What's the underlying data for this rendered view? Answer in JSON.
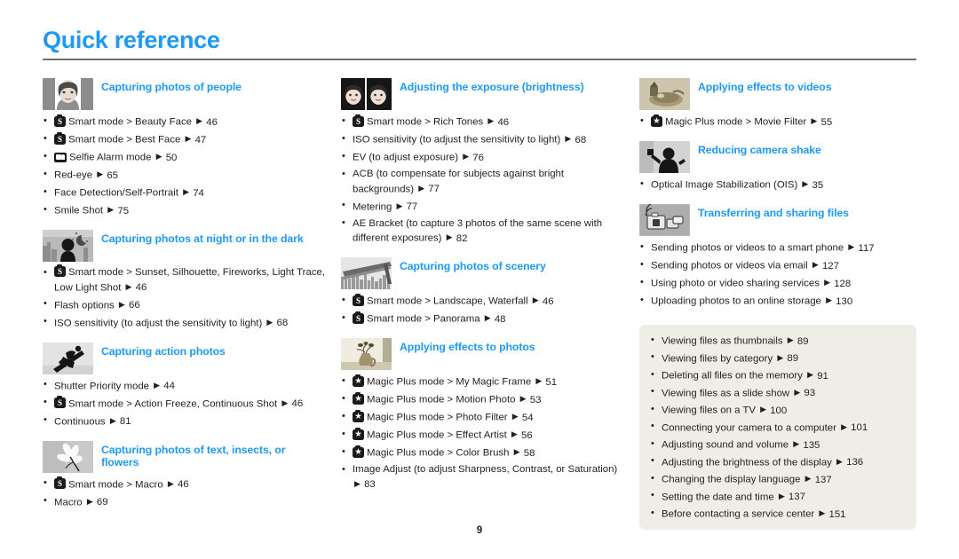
{
  "page": {
    "title": "Quick reference",
    "folio": "9",
    "accent_color": "#1e99f5",
    "text_color": "#231f20",
    "tipbox_color": "#efeee6",
    "rule_color": "#6f6f6f"
  },
  "columns": [
    {
      "sections": [
        {
          "title": "Capturing photos of people",
          "thumb_icon": "portrait-woman-thumbnail",
          "items": [
            {
              "badge": "smart-mode-badge",
              "text": "Smart mode > Beauty Face",
              "page": "46"
            },
            {
              "badge": "smart-mode-badge",
              "text": "Smart mode > Best Face",
              "page": "47"
            },
            {
              "badge": "selfie-alarm-badge",
              "text": "Selfie Alarm mode",
              "page": "50"
            },
            {
              "badge": null,
              "text": "Red-eye",
              "page": "65"
            },
            {
              "badge": null,
              "text": "Face Detection/Self-Portrait",
              "page": "74"
            },
            {
              "badge": null,
              "text": "Smile Shot",
              "page": "75"
            }
          ]
        },
        {
          "title": "Capturing photos at night or in the dark",
          "thumb_icon": "night-city-silhouette-thumbnail",
          "items": [
            {
              "badge": "smart-mode-badge",
              "text": "Smart mode > Sunset, Silhouette, Fireworks, Light Trace, Low Light Shot",
              "page": "46"
            },
            {
              "badge": null,
              "text": "Flash options",
              "page": "66"
            },
            {
              "badge": null,
              "text": "ISO sensitivity (to adjust the sensitivity to light)",
              "page": "68"
            }
          ]
        },
        {
          "title": "Capturing action photos",
          "thumb_icon": "snowboarder-thumbnail",
          "items": [
            {
              "badge": null,
              "text": "Shutter Priority mode",
              "page": "44"
            },
            {
              "badge": "smart-mode-badge",
              "text": "Smart mode > Action Freeze, Continuous Shot",
              "page": "46"
            },
            {
              "badge": null,
              "text": "Continuous",
              "page": "81"
            }
          ]
        },
        {
          "title": "Capturing photos of text, insects, or flowers",
          "thumb_icon": "flower-macro-thumbnail",
          "items": [
            {
              "badge": "smart-mode-badge",
              "text": "Smart mode > Macro",
              "page": "46"
            },
            {
              "badge": null,
              "text": "Macro",
              "page": "69"
            }
          ]
        }
      ]
    },
    {
      "sections": [
        {
          "title": "Adjusting the exposure (brightness)",
          "thumb_icon": "two-faces-exposure-thumbnail",
          "items": [
            {
              "badge": "smart-mode-badge",
              "text": "Smart mode > Rich Tones",
              "page": "46"
            },
            {
              "badge": null,
              "text": "ISO sensitivity (to adjust the sensitivity to light)",
              "page": "68"
            },
            {
              "badge": null,
              "text": "EV (to adjust exposure)",
              "page": "76"
            },
            {
              "badge": null,
              "text": "ACB (to compensate for subjects against bright backgrounds)",
              "page": "77"
            },
            {
              "badge": null,
              "text": "Metering",
              "page": "77"
            },
            {
              "badge": null,
              "text": "AE Bracket (to capture 3 photos of the same scene with different exposures)",
              "page": "82"
            }
          ]
        },
        {
          "title": "Capturing photos of scenery",
          "thumb_icon": "bridge-cityscape-thumbnail",
          "items": [
            {
              "badge": "smart-mode-badge",
              "text": "Smart mode > Landscape, Waterfall",
              "page": "46"
            },
            {
              "badge": "smart-mode-badge",
              "text": "Smart mode > Panorama",
              "page": "48"
            }
          ]
        },
        {
          "title": "Applying effects to photos",
          "thumb_icon": "vase-still-life-thumbnail",
          "items": [
            {
              "badge": "magic-plus-badge",
              "text": "Magic Plus mode > My Magic Frame",
              "page": "51"
            },
            {
              "badge": "magic-plus-badge",
              "text": "Magic Plus mode > Motion Photo",
              "page": "53"
            },
            {
              "badge": "magic-plus-badge",
              "text": "Magic Plus mode > Photo Filter",
              "page": "54"
            },
            {
              "badge": "magic-plus-badge",
              "text": "Magic Plus mode > Effect Artist",
              "page": "56"
            },
            {
              "badge": "magic-plus-badge",
              "text": "Magic Plus mode > Color Brush",
              "page": "58"
            },
            {
              "badge": null,
              "text": "Image Adjust (to adjust Sharpness, Contrast, or Saturation)",
              "page": "83"
            }
          ]
        }
      ]
    },
    {
      "sections": [
        {
          "title": "Applying effects to videos",
          "thumb_icon": "video-effects-thumbnail",
          "items": [
            {
              "badge": "magic-plus-badge",
              "text": "Magic Plus mode > Movie Filter",
              "page": "55"
            }
          ]
        },
        {
          "title": "Reducing camera shake",
          "thumb_icon": "camera-shake-person-thumbnail",
          "items": [
            {
              "badge": null,
              "text": "Optical Image Stabilization (OIS)",
              "page": "35"
            }
          ]
        },
        {
          "title": "Transferring and sharing files",
          "thumb_icon": "wireless-transfer-thumbnail",
          "items": [
            {
              "badge": null,
              "text": "Sending photos or videos to a smart phone",
              "page": "117"
            },
            {
              "badge": null,
              "text": "Sending photos or videos via email",
              "page": "127"
            },
            {
              "badge": null,
              "text": "Using photo or video sharing services",
              "page": "128"
            },
            {
              "badge": null,
              "text": "Uploading photos to an online storage",
              "page": "130"
            }
          ]
        }
      ],
      "tipbox": {
        "items": [
          {
            "badge": null,
            "text": "Viewing files as thumbnails",
            "page": "89"
          },
          {
            "badge": null,
            "text": "Viewing files by category",
            "page": "89"
          },
          {
            "badge": null,
            "text": "Deleting all files on the memory",
            "page": "91"
          },
          {
            "badge": null,
            "text": "Viewing files as a slide show",
            "page": "93"
          },
          {
            "badge": null,
            "text": "Viewing files on a TV",
            "page": "100"
          },
          {
            "badge": null,
            "text": "Connecting your camera to a computer",
            "page": "101"
          },
          {
            "badge": null,
            "text": "Adjusting sound and volume",
            "page": "135"
          },
          {
            "badge": null,
            "text": "Adjusting the brightness of the display",
            "page": "136"
          },
          {
            "badge": null,
            "text": "Changing the display language",
            "page": "137"
          },
          {
            "badge": null,
            "text": "Setting the date and time",
            "page": "137"
          },
          {
            "badge": null,
            "text": "Before contacting a service center",
            "page": "151"
          }
        ]
      }
    }
  ]
}
